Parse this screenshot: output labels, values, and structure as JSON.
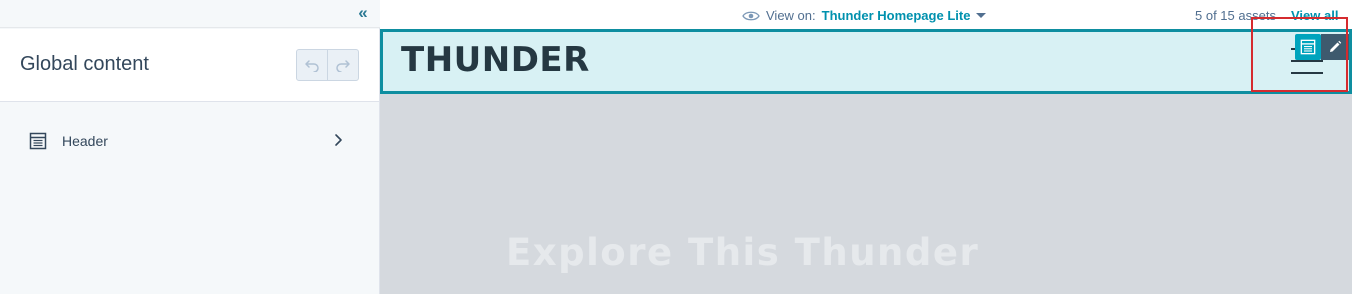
{
  "sidebar": {
    "collapse_icon": "double-chevron-left-icon",
    "title": "Global content",
    "undo_icon": "undo-icon",
    "redo_icon": "redo-icon",
    "items": [
      {
        "label": "Header",
        "icon": "module-layout-icon",
        "trailing_icon": "chevron-right-icon"
      }
    ]
  },
  "preview": {
    "view_on_label": "View on:",
    "view_on_value": "Thunder Homepage Lite",
    "assets_text": "5 of 15 assets",
    "view_all": "View all",
    "site": {
      "logo_text": "THUNDER",
      "hero_text": "Explore This Thunder",
      "menu_icon": "hamburger-menu-icon"
    },
    "module_actions": {
      "module_icon": "module-layout-icon",
      "edit_icon": "pencil-icon"
    }
  },
  "colors": {
    "accent": "#0091ae",
    "header_border": "#0e8ea0",
    "header_bg": "#d8f1f4",
    "highlight": "#d52b2f"
  }
}
